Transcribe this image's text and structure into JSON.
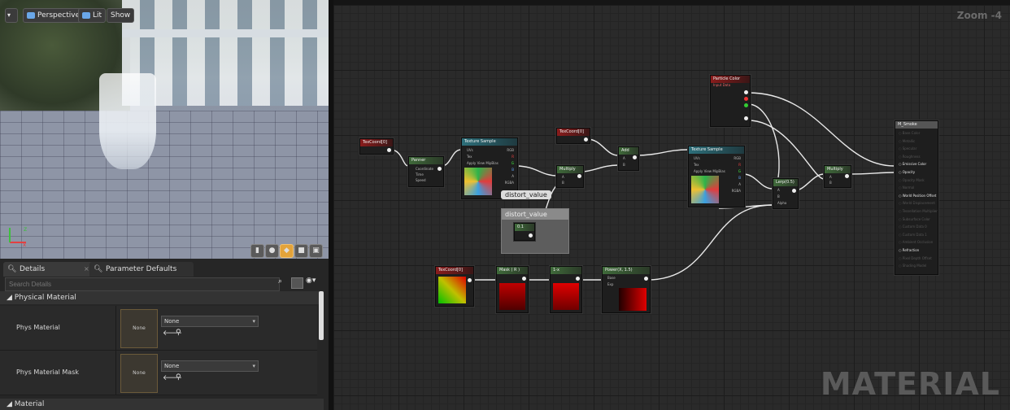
{
  "viewport": {
    "menu_icon": "chevron-down-icon",
    "perspective_label": "Perspective",
    "lit_label": "Lit",
    "show_label": "Show",
    "axis_z": "z",
    "axis_x": "x"
  },
  "panel": {
    "tabs": [
      {
        "label": "Details",
        "icon": "search-icon"
      },
      {
        "label": "Parameter Defaults",
        "icon": "search-icon"
      }
    ],
    "search_placeholder": "Search Details",
    "sections": [
      {
        "label": "Physical Material"
      },
      {
        "label": "Material"
      }
    ],
    "props": [
      {
        "label": "Phys Material",
        "thumb": "None",
        "value": "None"
      },
      {
        "label": "Phys Material Mask",
        "thumb": "None",
        "value": "None"
      }
    ]
  },
  "graph": {
    "zoom": "Zoom -4",
    "watermark": "MATERIAL",
    "nodes": {
      "texcoord1": "TexCoord[0]",
      "panner": "Panner",
      "panner_pins": [
        "Coordinate",
        "Time",
        "Speed"
      ],
      "texsample1": "Texture Sample",
      "texsample_pins": [
        "UVs",
        "Tex",
        "Apply View MipBias"
      ],
      "texsample_out": [
        "RGB",
        "R",
        "G",
        "B",
        "A",
        "RGBA"
      ],
      "texcoord2": "TexCoord[0]",
      "multiply1": "Multiply",
      "add": "Add",
      "texsample2": "Texture Sample",
      "particle": "Particle Color",
      "particle_sub": "Input Data",
      "lerp": "Lerp(0.5)",
      "lerp_pins": [
        "A",
        "B",
        "Alpha"
      ],
      "multiply2": "Multiply",
      "ab": [
        "A",
        "B"
      ],
      "comment_title": "distort_value",
      "bubble": "distort_value",
      "const": "0.1",
      "texcoord3": "TexCoord[0]",
      "mask": "Mask ( R )",
      "oneminus": "1-x",
      "power": "Power(X, 1.5)",
      "power_pins": [
        "Base",
        "Exp"
      ],
      "result": "M_Smoke",
      "result_pins": [
        "Base Color",
        "Metallic",
        "Specular",
        "Roughness",
        "Emissive Color",
        "Opacity",
        "Opacity Mask",
        "Normal",
        "World Position Offset",
        "World Displacement",
        "Tessellation Multiplier",
        "Subsurface Color",
        "Custom Data 0",
        "Custom Data 1",
        "Ambient Occlusion",
        "Refraction",
        "Pixel Depth Offset",
        "Shading Model"
      ]
    }
  }
}
